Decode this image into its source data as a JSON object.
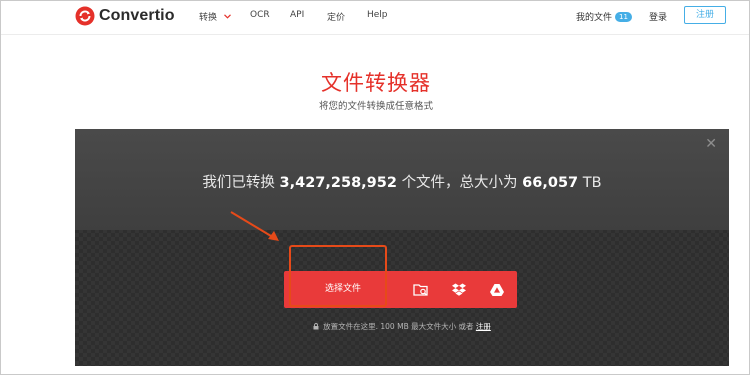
{
  "header": {
    "brand": "Convertio",
    "nav": [
      {
        "label": "转换",
        "has_dropdown": true
      },
      {
        "label": "OCR"
      },
      {
        "label": "API"
      },
      {
        "label": "定价"
      },
      {
        "label": "Help"
      }
    ],
    "my_files_label": "我的文件",
    "my_files_count": "11",
    "login_label": "登录",
    "signup_label": "注册"
  },
  "hero": {
    "title": "文件转换器",
    "subtitle": "将您的文件转换成任意格式"
  },
  "converter": {
    "stats_prefix": "我们已转换",
    "files_count": "3,427,258,952",
    "stats_mid": "个文件，总大小为",
    "total_size": "66,057",
    "size_unit": "TB",
    "choose_files_label": "选择文件",
    "source_icons": [
      "folder-search-icon",
      "dropbox-icon",
      "google-drive-icon"
    ],
    "hint_text": "放置文件在这里. 100 MB 最大文件大小 或者",
    "hint_link": "注册"
  },
  "colors": {
    "brand_red": "#e5312a",
    "button_red": "#e93a3a",
    "accent_blue": "#45aee6",
    "panel_dark": "#353535",
    "annotation_orange": "#e64a19"
  }
}
